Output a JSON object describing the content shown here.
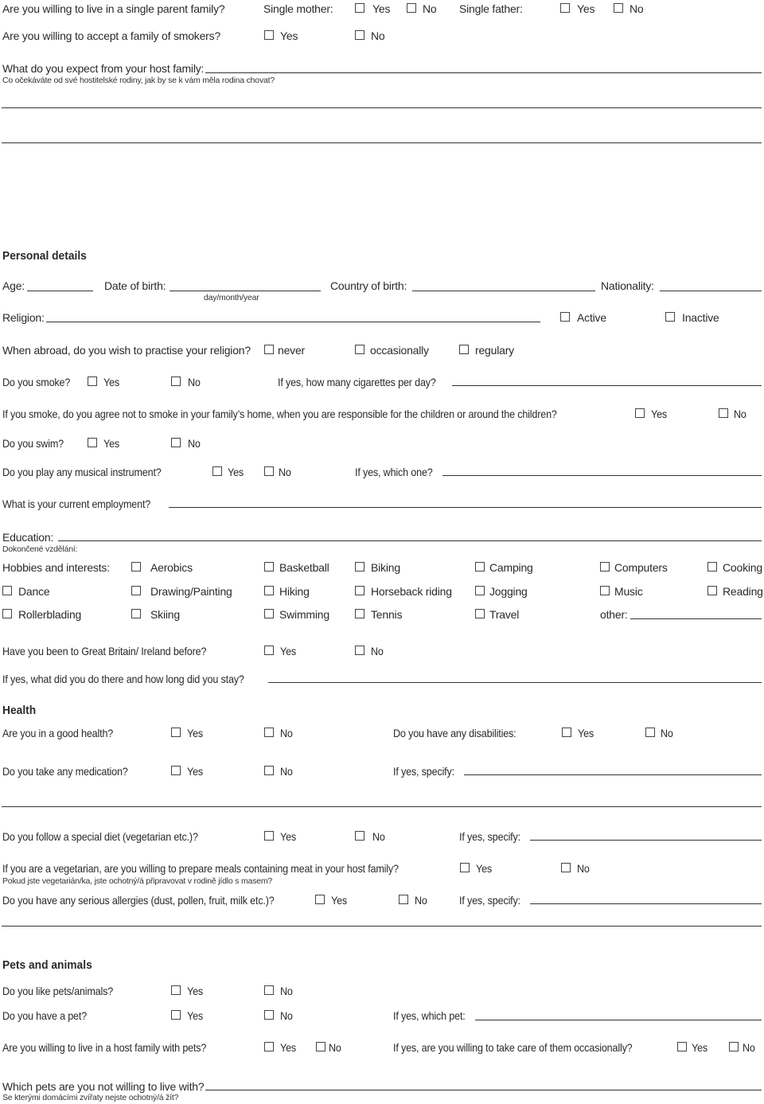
{
  "family": {
    "single_parent": {
      "question": "Are you willing to live in a single parent family?",
      "mother_label": "Single mother:",
      "father_label": "Single father:",
      "yes": "Yes",
      "no": "No"
    },
    "smokers": {
      "question": "Are you willing to accept a family of smokers?",
      "yes": "Yes",
      "no": "No"
    },
    "expect": {
      "question": "What do you expect from your host family:",
      "translation": "Co očekáváte od své hostitelské rodiny, jak by se k vám měla rodina chovat?"
    }
  },
  "personal": {
    "heading": "Personal details",
    "age": "Age:",
    "dob": "Date of birth:",
    "dob_hint": "day/month/year",
    "country": "Country of birth:",
    "nationality": "Nationality:",
    "religion": "Religion:",
    "active": "Active",
    "inactive": "Inactive",
    "practise": {
      "question": "When abroad, do you wish to practise your religion?",
      "options": [
        "never",
        "occasionally",
        "regulary"
      ]
    },
    "smoke": {
      "question": "Do you smoke?",
      "yes": "Yes",
      "no": "No",
      "followup": "If yes, how many cigarettes per day?"
    },
    "smoke_agree": {
      "question": "If you smoke, do you agree not to smoke in your family’s home, when you are responsible for the children or around the children?",
      "yes": "Yes",
      "no": "No"
    },
    "swim": {
      "question": "Do you swim?",
      "yes": "Yes",
      "no": "No"
    },
    "instrument": {
      "question": "Do you play any musical instrument?",
      "yes": "Yes",
      "no": "No",
      "followup": "If yes, which one?"
    },
    "employment": "What is your current employment?",
    "education": "Education:",
    "education_translation": "Dokončené vzdělání:",
    "hobbies_label": "Hobbies and interests:",
    "hobbies": [
      "Aerobics",
      "Basketball",
      "Biking",
      "Camping",
      "Computers",
      "Cooking",
      "Dance",
      "Drawing/Painting",
      "Hiking",
      "Horseback riding",
      "Jogging",
      "Music",
      "Reading",
      "Rollerblading",
      "Skiing",
      "Swimming",
      "Tennis",
      "Travel"
    ],
    "other": "other:",
    "gb": {
      "question": "Have you been to Great Britain/ Ireland before?",
      "yes": "Yes",
      "no": "No",
      "followup": "If yes, what did you do there and how long did you stay?"
    }
  },
  "health": {
    "heading": "Health",
    "good_health": {
      "question": "Are you in a good health?",
      "yes": "Yes",
      "no": "No"
    },
    "disabilities": {
      "question": "Do you have any disabilities:",
      "yes": "Yes",
      "no": "No"
    },
    "medication": {
      "question": "Do you take any medication?",
      "yes": "Yes",
      "no": "No",
      "followup": "If yes, specify:"
    },
    "diet": {
      "question": "Do you follow a special diet (vegetarian etc.)?",
      "yes": "Yes",
      "no": "No",
      "followup": "If yes, specify:"
    },
    "vegetarian": {
      "question": "If you are a vegetarian, are you willing to prepare meals containing meat in your host family?",
      "yes": "Yes",
      "no": "No",
      "translation": "Pokud jste vegetarián/ka, jste ochotný/á připravovat v rodině jídlo s masem?"
    },
    "allergies": {
      "question": "Do you have any serious allergies (dust, pollen, fruit, milk etc.)?",
      "yes": "Yes",
      "no": "No",
      "followup": "If yes, specify:"
    }
  },
  "pets": {
    "heading": "Pets and animals",
    "like": {
      "question": "Do you like pets/animals?",
      "yes": "Yes",
      "no": "No"
    },
    "have": {
      "question": "Do you have a pet?",
      "yes": "Yes",
      "no": "No",
      "followup": "If yes, which pet:"
    },
    "live_with": {
      "question": "Are you willing to live in a host family with pets?",
      "yes": "Yes",
      "no": "No"
    },
    "care": {
      "question": "If yes, are you willing to take care of them occasionally?",
      "yes": "Yes",
      "no": "No"
    },
    "not_willing": {
      "question": "Which pets are you not willing to live with?",
      "translation": "Se kterými domácími zvířaty nejste ochotný/á žít?"
    }
  }
}
